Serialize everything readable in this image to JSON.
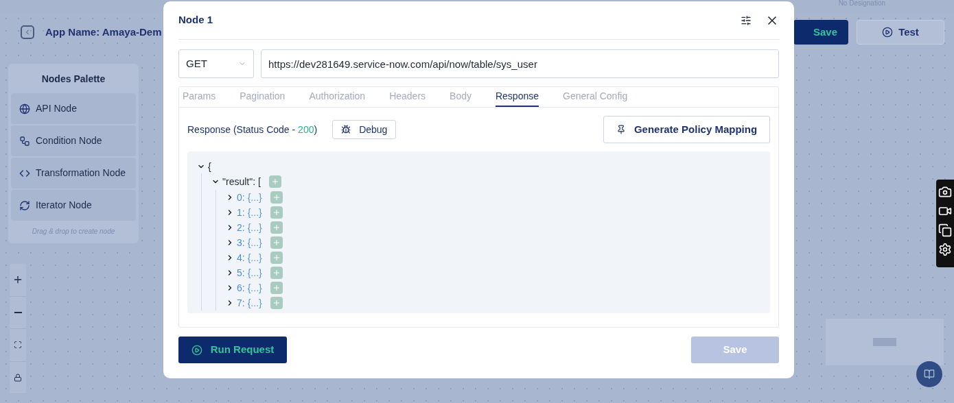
{
  "header": {
    "designation": "No Designation"
  },
  "app": {
    "name": "App Name: Amaya-Dem",
    "buttons": [
      {
        "label": "Save",
        "kind": "primary"
      },
      {
        "label": "Test",
        "kind": "secondary"
      }
    ]
  },
  "palette": {
    "title": "Nodes Palette",
    "items": [
      {
        "label": "API Node",
        "kind": "api"
      },
      {
        "label": "Condition Node",
        "kind": "condition"
      },
      {
        "label": "Transformation Node",
        "kind": "transformation"
      },
      {
        "label": "Iterator Node",
        "kind": "iterator"
      }
    ],
    "hint": "Drag & drop to create node"
  },
  "modal": {
    "title": "Node 1",
    "method": "GET",
    "url": "https://dev281649.service-now.com/api/now/table/sys_user",
    "tabs": [
      {
        "label": "Params",
        "selected": false
      },
      {
        "label": "Pagination",
        "selected": false
      },
      {
        "label": "Authorization",
        "selected": false
      },
      {
        "label": "Headers",
        "selected": false
      },
      {
        "label": "Body",
        "selected": false
      },
      {
        "label": "Response",
        "selected": true
      },
      {
        "label": "General Config",
        "selected": false
      }
    ],
    "response": {
      "label": "Response (Status Code - ",
      "status_code": "200",
      "close": ")",
      "debug": "Debug",
      "generate": "Generate Policy Mapping"
    },
    "tree": {
      "open": "{",
      "expanded": true,
      "children": [
        {
          "key": "\"result\":",
          "open": "[",
          "expanded": true,
          "children": [
            {
              "key": "0:",
              "value": "{...}",
              "expanded": false
            },
            {
              "key": "1:",
              "value": "{...}",
              "expanded": false
            },
            {
              "key": "2:",
              "value": "{...}",
              "expanded": false
            },
            {
              "key": "3:",
              "value": "{...}",
              "expanded": false
            },
            {
              "key": "4:",
              "value": "{...}",
              "expanded": false
            },
            {
              "key": "5:",
              "value": "{...}",
              "expanded": false
            },
            {
              "key": "6:",
              "value": "{...}",
              "expanded": false
            },
            {
              "key": "7:",
              "value": "{...}",
              "expanded": false
            }
          ]
        }
      ]
    },
    "run": "Run Request",
    "save": {
      "label": "Save",
      "disabled": true
    }
  }
}
